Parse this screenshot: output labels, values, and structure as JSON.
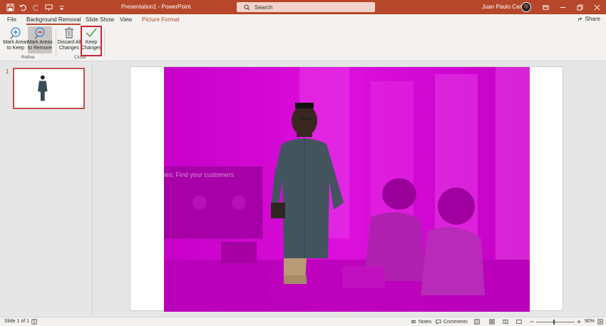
{
  "titlebar": {
    "document_title": "Presentation1 - PowerPoint",
    "search_placeholder": "Search",
    "user_name": "Juan Paulo Cariño",
    "icons": [
      "save-icon",
      "undo-icon",
      "redo-icon",
      "present-icon",
      "customize-qat-icon"
    ]
  },
  "tabs": [
    {
      "label": "File"
    },
    {
      "label": "Background Removal"
    },
    {
      "label": "Slide Show"
    },
    {
      "label": "View"
    },
    {
      "label": "Picture Format"
    }
  ],
  "share_label": "Share",
  "ribbon": {
    "mark_keep": "Mark Areas\nto Keep",
    "mark_remove": "Mark Areas\nto Remove",
    "discard": "Discard All\nChanges",
    "keep_changes": "Keep\nChanges",
    "group_refine": "Refine",
    "group_close": "Close"
  },
  "slides_pane": {
    "slide_number": "1"
  },
  "slide": {
    "background_text": "ies: Find your customers"
  },
  "statusbar": {
    "slide_info": "Slide 1 of 1",
    "notes": "Notes",
    "comments": "Comments",
    "zoom": "90%"
  },
  "colors": {
    "accent": "#b7472a",
    "removal_overlay": "#d600d6",
    "highlight_box": "#c5283a"
  }
}
